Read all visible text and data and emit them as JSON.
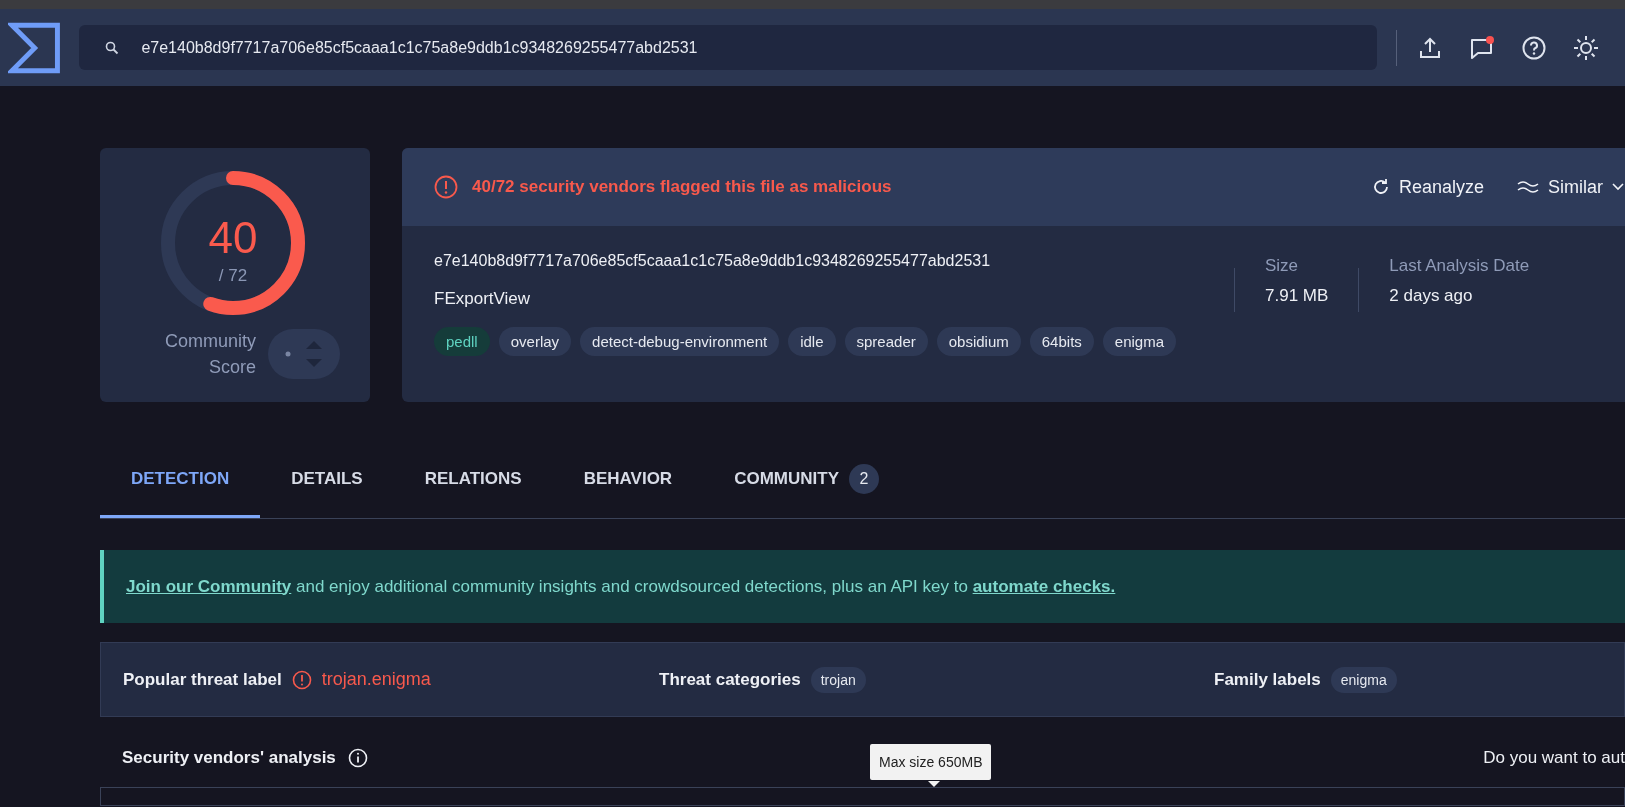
{
  "search": {
    "value": "e7e140b8d9f7717a706e85cf5caaa1c1c75a8e9ddb1c9348269255477abd2531"
  },
  "notifications": {
    "unread": true
  },
  "score": {
    "detections": "40",
    "total": "/ 72",
    "level": 0.556,
    "community_label": "Community Score"
  },
  "alert": {
    "text": "40/72 security vendors flagged this file as malicious",
    "actions": [
      "Reanalyze",
      "Similar"
    ]
  },
  "file": {
    "hash": "e7e140b8d9f7717a706e85cf5caaa1c1c75a8e9ddb1c9348269255477abd2531",
    "name": "FExportView",
    "tags": [
      {
        "label": "pedll",
        "highlighted": true
      },
      {
        "label": "overlay",
        "highlighted": false
      },
      {
        "label": "detect-debug-environment",
        "highlighted": false
      },
      {
        "label": "idle",
        "highlighted": false
      },
      {
        "label": "spreader",
        "highlighted": false
      },
      {
        "label": "obsidium",
        "highlighted": false
      },
      {
        "label": "64bits",
        "highlighted": false
      },
      {
        "label": "enigma",
        "highlighted": false
      }
    ],
    "stats": [
      {
        "label": "Size",
        "value": "7.91 MB"
      },
      {
        "label": "Last Analysis Date",
        "value": "2 days ago"
      }
    ]
  },
  "tabs": [
    {
      "label": "DETECTION",
      "selected": true
    },
    {
      "label": "DETAILS",
      "selected": false
    },
    {
      "label": "RELATIONS",
      "selected": false
    },
    {
      "label": "BEHAVIOR",
      "selected": false
    },
    {
      "label": "COMMUNITY",
      "selected": false,
      "count": "2"
    }
  ],
  "banner": [
    {
      "kind": "link",
      "text": "Join our Community"
    },
    {
      "kind": "text",
      "text": " and enjoy additional community insights and crowdsourced detections, plus an API key to "
    },
    {
      "kind": "link",
      "text": "automate checks."
    }
  ],
  "threat": {
    "popular_label": "Popular threat label",
    "popular_value": "trojan.enigma",
    "categories_label": "Threat categories",
    "categories": [
      "trojan"
    ],
    "family_label": "Family labels",
    "families": [
      "enigma"
    ]
  },
  "vendors": {
    "title": "Security vendors' analysis",
    "prompt": "Do you want to aut"
  },
  "tooltip": "Max size 650MB"
}
